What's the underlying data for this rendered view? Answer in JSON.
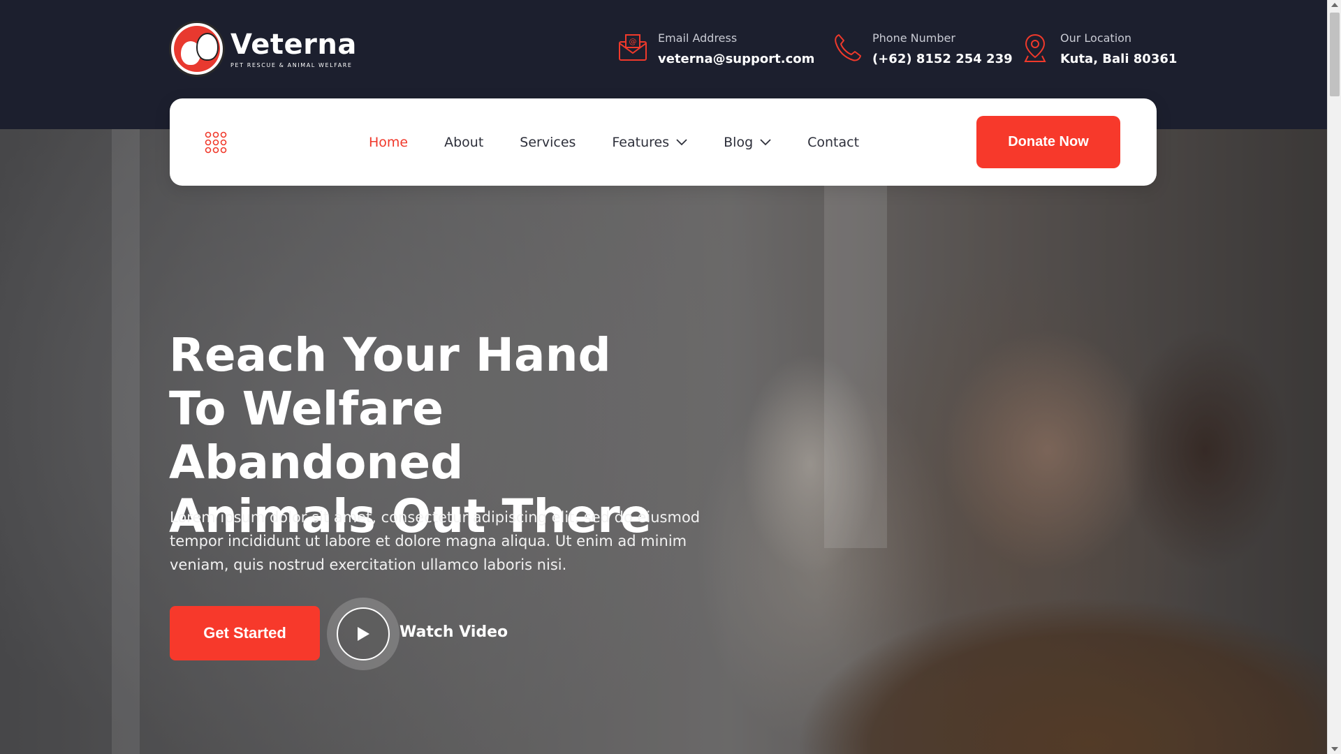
{
  "brand": {
    "name": "Veterna",
    "tagline": "PET RESCUE & ANIMAL WELFARE"
  },
  "contacts": {
    "email": {
      "label": "Email Address",
      "value": "veterna@support.com",
      "icon": "envelope-icon"
    },
    "phone": {
      "label": "Phone Number",
      "value": "(+62) 8152 254 239",
      "icon": "phone-icon"
    },
    "location": {
      "label": "Our Location",
      "value": "Kuta, Bali 80361",
      "icon": "location-pin-icon"
    }
  },
  "nav": {
    "menu_icon": "grid-menu-icon",
    "items": [
      {
        "label": "Home",
        "active": true
      },
      {
        "label": "About"
      },
      {
        "label": "Services"
      },
      {
        "label": "Features",
        "dropdown": true
      },
      {
        "label": "Blog",
        "dropdown": true
      },
      {
        "label": "Contact"
      }
    ],
    "cta_label": "Donate Now"
  },
  "hero": {
    "title_lines": [
      "Reach Your Hand",
      "To Welfare Abandoned",
      "Animals Out There"
    ],
    "description": "Lorem ipsum dolor sit amet, consectetur adipiscing elit, sed do eiusmod tempor incididunt ut labore et dolore magna aliqua. Ut enim ad minim veniam, quis nostrud exercitation ullamco laboris nisi.",
    "primary_cta": "Get Started",
    "video_label": "Watch Video"
  },
  "colors": {
    "accent": "#f7392b",
    "header_bg": "#1c1f2e",
    "nav_text": "#2d2f3a",
    "white": "#ffffff"
  }
}
